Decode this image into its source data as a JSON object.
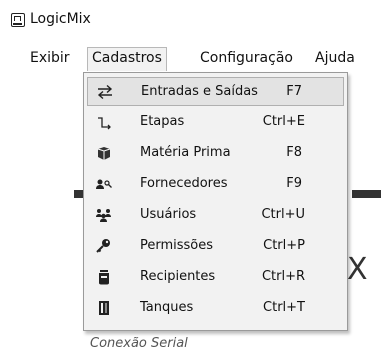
{
  "window": {
    "title": "LogicMix"
  },
  "menubar": {
    "items": [
      {
        "label": "Exibir"
      },
      {
        "label": "Cadastros"
      },
      {
        "label": "Configuração"
      },
      {
        "label": "Ajuda"
      }
    ]
  },
  "dropdown": {
    "items": [
      {
        "icon": "swap-arrows-icon",
        "label": "Entradas e Saídas",
        "shortcut": "F7",
        "highlighted": true
      },
      {
        "icon": "stage-icon",
        "label": "Etapas",
        "shortcut": "Ctrl+E"
      },
      {
        "icon": "box-icon",
        "label": "Matéria Prima",
        "shortcut": "F8"
      },
      {
        "icon": "supplier-icon",
        "label": "Fornecedores",
        "shortcut": "F9"
      },
      {
        "icon": "users-icon",
        "label": "Usuários",
        "shortcut": "Ctrl+U"
      },
      {
        "icon": "key-icon",
        "label": "Permissões",
        "shortcut": "Ctrl+P"
      },
      {
        "icon": "container-icon",
        "label": "Recipientes",
        "shortcut": "Ctrl+R"
      },
      {
        "icon": "tank-icon",
        "label": "Tanques",
        "shortcut": "Ctrl+T"
      }
    ]
  },
  "background": {
    "x_glyph": "X",
    "footer_label": "Conexão Serial"
  }
}
